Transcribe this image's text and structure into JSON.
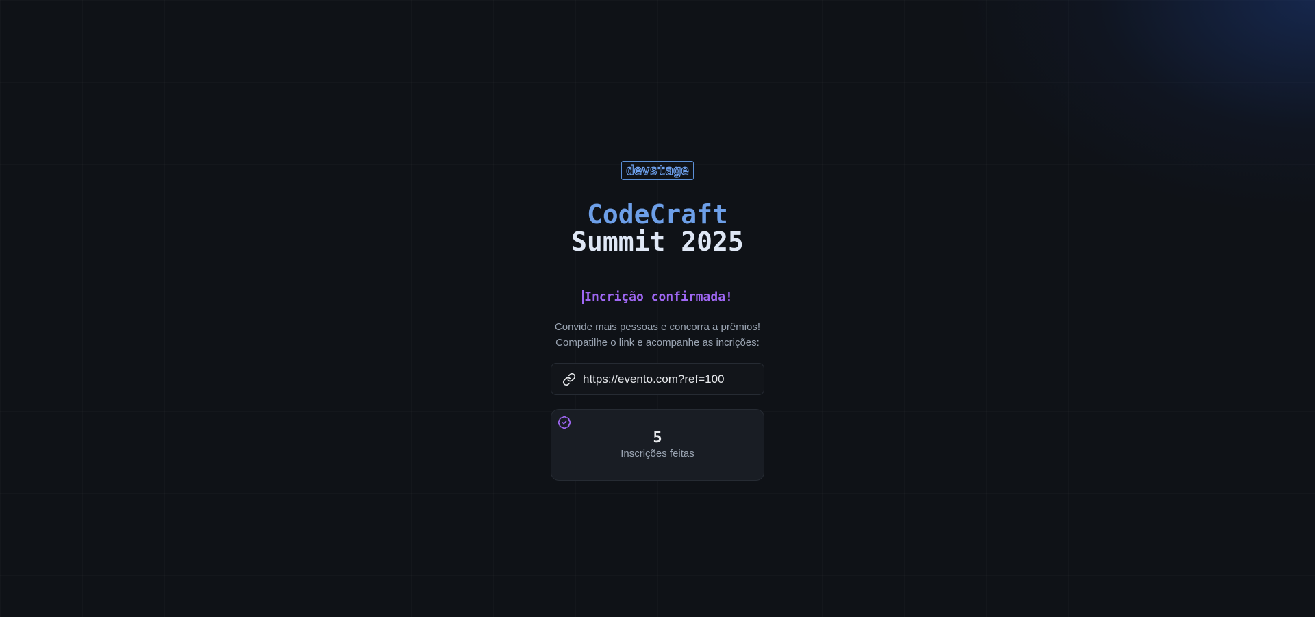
{
  "logo": {
    "text": "devstage"
  },
  "event": {
    "title_line1": "CodeCraft",
    "title_line2": "Summit 2025"
  },
  "confirmation": {
    "heading": "Incrição confirmada!",
    "description_line1": "Convide mais pessoas e concorra a prêmios!",
    "description_line2": "Compatilhe o link e acompanhe as incrições:"
  },
  "invite_link": {
    "icon": "link-icon",
    "url": "https://evento.com?ref=100"
  },
  "stats": {
    "icon": "badge-check-icon",
    "value": "5",
    "label": "Inscrições feitas"
  },
  "colors": {
    "background": "#0f1217",
    "accent_blue": "#6d9fe8",
    "accent_purple": "#9f67f3",
    "title_light": "#dfe7f5",
    "muted_text": "#9aa4b2"
  }
}
